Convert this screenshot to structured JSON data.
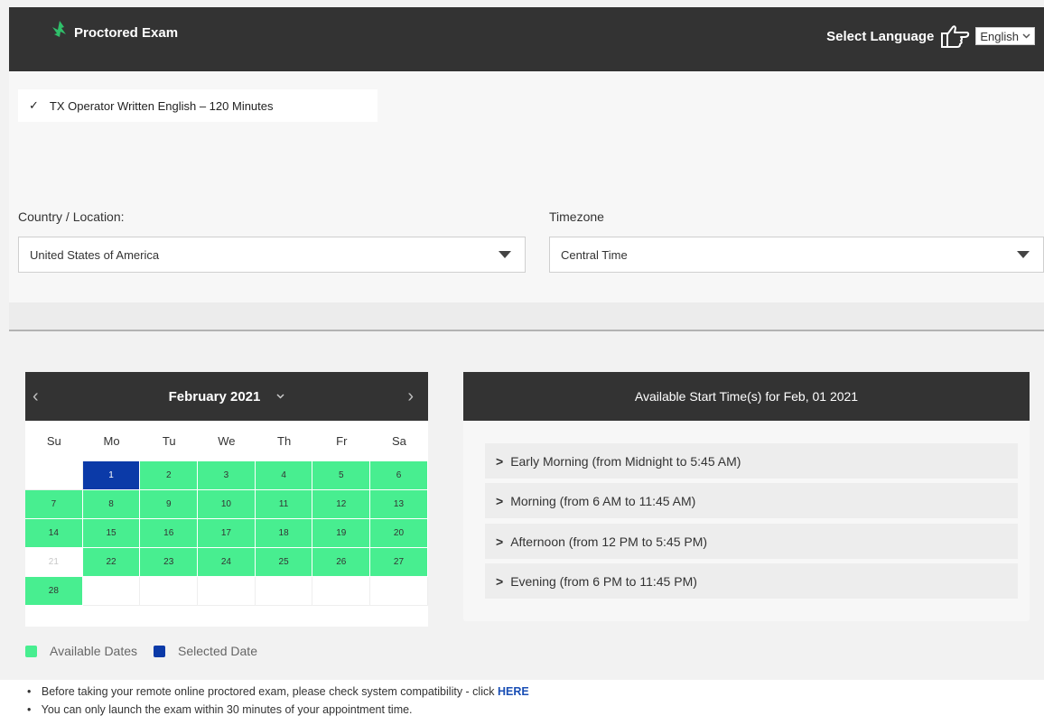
{
  "header": {
    "title": "Proctored Exam",
    "language_label": "Select Language",
    "language_value": "English"
  },
  "exam": {
    "name": "TX Operator Written English – 120 Minutes"
  },
  "location": {
    "country_label": "Country / Location:",
    "country_value": "United States of America",
    "timezone_label": "Timezone",
    "timezone_value": "Central Time"
  },
  "calendar": {
    "month_label": "February 2021",
    "weekdays": [
      "Su",
      "Mo",
      "Tu",
      "We",
      "Th",
      "Fr",
      "Sa"
    ],
    "weeks": [
      [
        {
          "d": "",
          "s": "empty"
        },
        {
          "d": "1",
          "s": "selected"
        },
        {
          "d": "2",
          "s": "avail"
        },
        {
          "d": "3",
          "s": "avail"
        },
        {
          "d": "4",
          "s": "avail"
        },
        {
          "d": "5",
          "s": "avail"
        },
        {
          "d": "6",
          "s": "avail"
        }
      ],
      [
        {
          "d": "7",
          "s": "avail"
        },
        {
          "d": "8",
          "s": "avail"
        },
        {
          "d": "9",
          "s": "avail"
        },
        {
          "d": "10",
          "s": "avail"
        },
        {
          "d": "11",
          "s": "avail"
        },
        {
          "d": "12",
          "s": "avail"
        },
        {
          "d": "13",
          "s": "avail"
        }
      ],
      [
        {
          "d": "14",
          "s": "avail"
        },
        {
          "d": "15",
          "s": "avail"
        },
        {
          "d": "16",
          "s": "avail"
        },
        {
          "d": "17",
          "s": "avail"
        },
        {
          "d": "18",
          "s": "avail"
        },
        {
          "d": "19",
          "s": "avail"
        },
        {
          "d": "20",
          "s": "avail"
        }
      ],
      [
        {
          "d": "21",
          "s": "disabled"
        },
        {
          "d": "22",
          "s": "avail"
        },
        {
          "d": "23",
          "s": "avail"
        },
        {
          "d": "24",
          "s": "avail"
        },
        {
          "d": "25",
          "s": "avail"
        },
        {
          "d": "26",
          "s": "avail"
        },
        {
          "d": "27",
          "s": "avail"
        }
      ],
      [
        {
          "d": "28",
          "s": "avail"
        },
        {
          "d": "",
          "s": "empty"
        },
        {
          "d": "",
          "s": "empty"
        },
        {
          "d": "",
          "s": "empty"
        },
        {
          "d": "",
          "s": "empty"
        },
        {
          "d": "",
          "s": "empty"
        },
        {
          "d": "",
          "s": "empty"
        }
      ]
    ]
  },
  "legend": {
    "available_label": "Available Dates",
    "selected_label": "Selected Date"
  },
  "times": {
    "header": "Available Start Time(s) for Feb, 01 2021",
    "slots": [
      "Early Morning (from Midnight to 5:45 AM)",
      "Morning (from 6 AM to 11:45 AM)",
      "Afternoon (from 12 PM to 5:45 PM)",
      "Evening (from 6 PM to 11:45 PM)"
    ]
  },
  "notes": {
    "line1": "Before taking your remote online proctored exam, please check system compatibility - click",
    "line1_link": "HERE",
    "line2": "You can only launch the exam within 30 minutes of your appointment time."
  },
  "colors": {
    "header_bg": "#333333",
    "available": "#48ee90",
    "selected": "#0b3aa8",
    "link": "#1a4fb5"
  },
  "icons": {
    "brand": "leaf-icon",
    "language": "pointing-hand-icon",
    "check": "checkmark-icon"
  }
}
